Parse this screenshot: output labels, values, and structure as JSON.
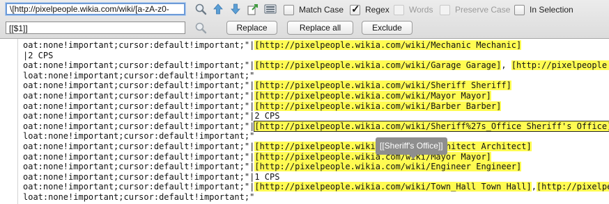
{
  "find": {
    "value": "\\[http://pixelpeople.wikia.com/wiki/[a-zA-z0-",
    "replace_value": "[[$1]]"
  },
  "toolbar": {
    "icons": [
      "find-icon",
      "arrow-up-icon",
      "arrow-down-icon",
      "export-icon",
      "keyboard-icon"
    ],
    "options": [
      {
        "label": "Match Case",
        "checked": false,
        "enabled": true
      },
      {
        "label": "Regex",
        "checked": true,
        "enabled": true
      },
      {
        "label": "Words",
        "checked": false,
        "enabled": false
      },
      {
        "label": "Preserve Case",
        "checked": false,
        "enabled": false
      },
      {
        "label": "In Selection",
        "checked": false,
        "enabled": true
      }
    ],
    "replace_label": "Replace",
    "replace_all_label": "Replace all",
    "exclude_label": "Exclude"
  },
  "colors": {
    "highlight": "#fffb52",
    "tooltip": "#8e8e8e"
  },
  "editor": {
    "lines": [
      {
        "pre": "oat:none!important;cursor:default!important;\"|",
        "hl": "[http://pixelpeople.wikia.com/wiki/Mechanic Mechanic]",
        "post": ""
      },
      {
        "pre": "|2 CPS",
        "hl": "",
        "post": ""
      },
      {
        "pre": "oat:none!important;cursor:default!important;\"|",
        "hl": "[http://pixelpeople.wikia.com/wiki/Garage Garage]",
        "post": ", ",
        "hl2": "[http://pixelpeople.wiki"
      },
      {
        "pre": "loat:none!important;cursor:default!important;\"",
        "hl": "",
        "post": ""
      },
      {
        "pre": "oat:none!important;cursor:default!important;\"|",
        "hl": "[http://pixelpeople.wikia.com/wiki/Sheriff Sheriff]",
        "post": ""
      },
      {
        "pre": "oat:none!important;cursor:default!important;\"|",
        "hl": "[http://pixelpeople.wikia.com/wiki/Mayor Mayor]",
        "post": ""
      },
      {
        "pre": "oat:none!important;cursor:default!important;\"|",
        "hl": "[http://pixelpeople.wikia.com/wiki/Barber Barber]",
        "post": ""
      },
      {
        "pre": "oat:none!important;cursor:default!important;\"|2 CPS",
        "hl": "",
        "post": ""
      },
      {
        "pre": "oat:none!important;cursor:default!important;\"|",
        "hl": "[http://pixelpeople.wikia.com/wiki/Sheriff%27s_Office Sheriff's Office]",
        "post": "",
        "current": true
      },
      {
        "pre": "loat:none!important;cursor:default!important;\"",
        "hl": "",
        "post": ""
      },
      {
        "pre": "oat:none!important;cursor:default!important;\"|",
        "hl": "[http://pixelpeople.wikia.com/wiki/Architect Architect]",
        "post": ""
      },
      {
        "pre": "oat:none!important;cursor:default!important;\"|",
        "hl": "[http://pixelpeople.wikia.com/wiki/Mayor Mayor]",
        "post": ""
      },
      {
        "pre": "oat:none!important;cursor:default!important;\"|",
        "hl": "[http://pixelpeople.wikia.com/wiki/Engineer Engineer]",
        "post": ""
      },
      {
        "pre": "oat:none!important;cursor:default!important;\"|1 CPS",
        "hl": "",
        "post": ""
      },
      {
        "pre": "oat:none!important;cursor:default!important;\"|",
        "hl": "[http://pixelpeople.wikia.com/wiki/Town_Hall Town Hall]",
        "post": ",",
        "hl2": "[http://pixelpeople"
      },
      {
        "pre": "loat:none!important;cursor:default!important;\"",
        "hl": "",
        "post": ""
      }
    ],
    "tooltip": "[[Sheriff's Office]]"
  }
}
